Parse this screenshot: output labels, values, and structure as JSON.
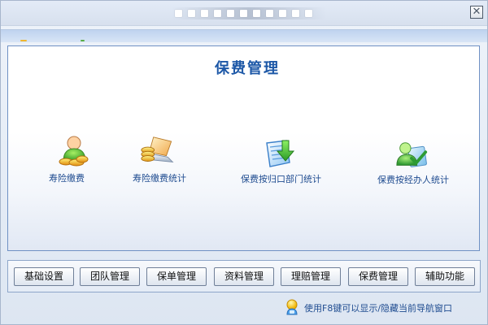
{
  "window": {
    "title": "",
    "close_label": "✕"
  },
  "main": {
    "title": "保费管理",
    "modules": [
      {
        "label": "寿险缴费",
        "icon": "person-money-icon"
      },
      {
        "label": "寿险缴费统计",
        "icon": "laptop-coins-icon"
      },
      {
        "label": "保费按归口部门统计",
        "icon": "document-download-icon"
      },
      {
        "label": "保费按经办人统计",
        "icon": "person-check-icon"
      }
    ]
  },
  "toolbar": {
    "buttons": [
      {
        "label": "基础设置"
      },
      {
        "label": "团队管理"
      },
      {
        "label": "保单管理"
      },
      {
        "label": "资料管理"
      },
      {
        "label": "理赔管理"
      },
      {
        "label": "保费管理"
      },
      {
        "label": "辅助功能"
      }
    ]
  },
  "status": {
    "hint": "使用F8键可以显示/隐藏当前导航窗口",
    "icon": "lightbulb-person-icon"
  },
  "colors": {
    "accent": "#1d58a7",
    "border": "#6f91c4",
    "panel_bottom": "#e1e8f4"
  }
}
